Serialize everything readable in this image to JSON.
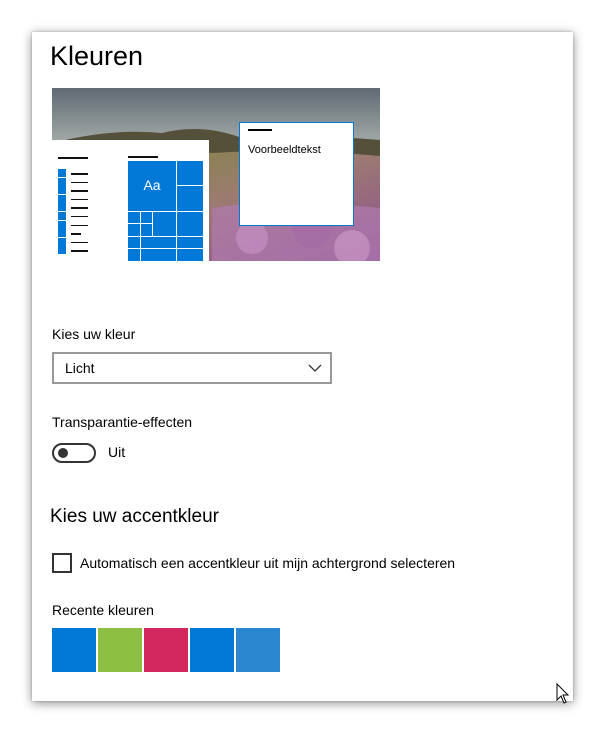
{
  "page": {
    "title": "Kleuren"
  },
  "preview": {
    "sample_text": "Voorbeeldtekst",
    "tile_label": "Aa",
    "accent_color": "#0078d7"
  },
  "color_mode": {
    "label": "Kies uw kleur",
    "selected": "Licht"
  },
  "transparency": {
    "label": "Transparantie-effecten",
    "state_text": "Uit",
    "enabled": false
  },
  "accent": {
    "heading": "Kies uw accentkleur",
    "auto_select_label": "Automatisch een accentkleur uit mijn achtergrond selecteren",
    "auto_select_checked": false,
    "recent_label": "Recente kleuren",
    "recent_colors": [
      "#0078d7",
      "#8cbf44",
      "#d3285f",
      "#0078d7",
      "#2a86cf"
    ]
  }
}
